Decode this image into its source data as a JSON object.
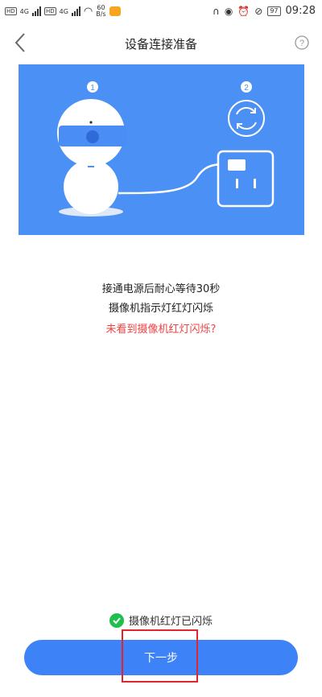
{
  "status_bar": {
    "net1": "4G",
    "net2": "4G",
    "speed_value": "60",
    "speed_unit": "B/s",
    "battery": "97",
    "time": "09:28"
  },
  "header": {
    "title": "设备连接准备"
  },
  "illustration": {
    "step1": "1",
    "step2": "2",
    "bg_color": "#4a90f5"
  },
  "instructions": {
    "line1": "接通电源后耐心等待30秒",
    "line2": "摄像机指示灯红灯闪烁",
    "help_link": "未看到摄像机红灯闪烁?"
  },
  "confirm": {
    "label": "摄像机红灯已闪烁",
    "checked": true
  },
  "next_button": {
    "label": "下一步"
  },
  "colors": {
    "primary": "#3e82f7",
    "link_red": "#f04142",
    "check_green": "#1fbf4b"
  }
}
